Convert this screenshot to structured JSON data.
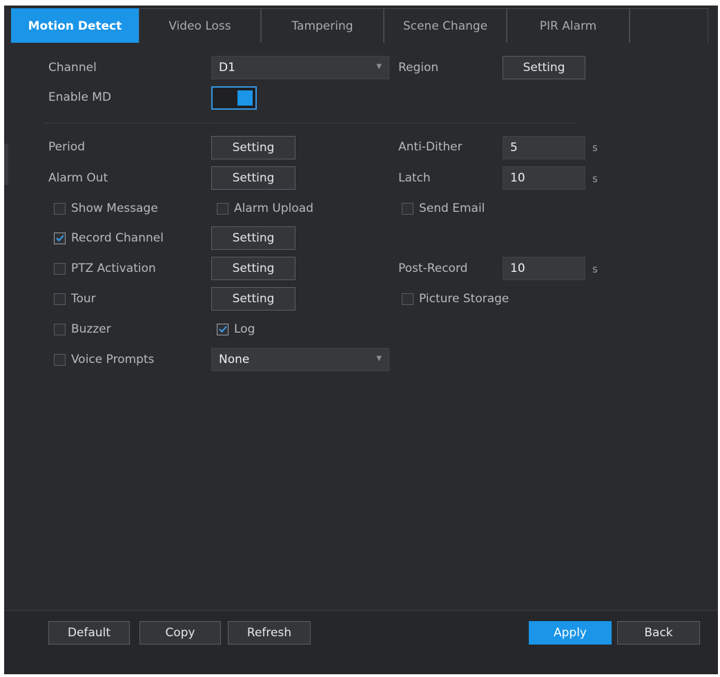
{
  "tabs": [
    {
      "label": "Motion Detect",
      "active": true
    },
    {
      "label": "Video Loss",
      "active": false
    },
    {
      "label": "Tampering",
      "active": false
    },
    {
      "label": "Scene Change",
      "active": false
    },
    {
      "label": "PIR Alarm",
      "active": false
    }
  ],
  "channel": {
    "label": "Channel",
    "value": "D1"
  },
  "region": {
    "label": "Region",
    "button": "Setting"
  },
  "enable_md": {
    "label": "Enable MD",
    "on": true
  },
  "period": {
    "label": "Period",
    "button": "Setting"
  },
  "anti_dither": {
    "label": "Anti-Dither",
    "value": "5",
    "unit": "s"
  },
  "alarm_out": {
    "label": "Alarm Out",
    "button": "Setting"
  },
  "latch": {
    "label": "Latch",
    "value": "10",
    "unit": "s"
  },
  "show_message": {
    "label": "Show Message",
    "checked": false
  },
  "alarm_upload": {
    "label": "Alarm Upload",
    "checked": false
  },
  "send_email": {
    "label": "Send Email",
    "checked": false
  },
  "record_channel": {
    "label": "Record Channel",
    "checked": true,
    "button": "Setting"
  },
  "ptz_activation": {
    "label": "PTZ Activation",
    "checked": false,
    "button": "Setting"
  },
  "post_record": {
    "label": "Post-Record",
    "value": "10",
    "unit": "s"
  },
  "tour": {
    "label": "Tour",
    "checked": false,
    "button": "Setting"
  },
  "picture_storage": {
    "label": "Picture Storage",
    "checked": false
  },
  "buzzer": {
    "label": "Buzzer",
    "checked": false
  },
  "log": {
    "label": "Log",
    "checked": true
  },
  "voice_prompts": {
    "label": "Voice Prompts",
    "checked": false,
    "value": "None"
  },
  "footer": {
    "default": "Default",
    "copy": "Copy",
    "refresh": "Refresh",
    "apply": "Apply",
    "back": "Back"
  },
  "colors": {
    "accent": "#1a95e8",
    "background": "#2a2b2e"
  }
}
